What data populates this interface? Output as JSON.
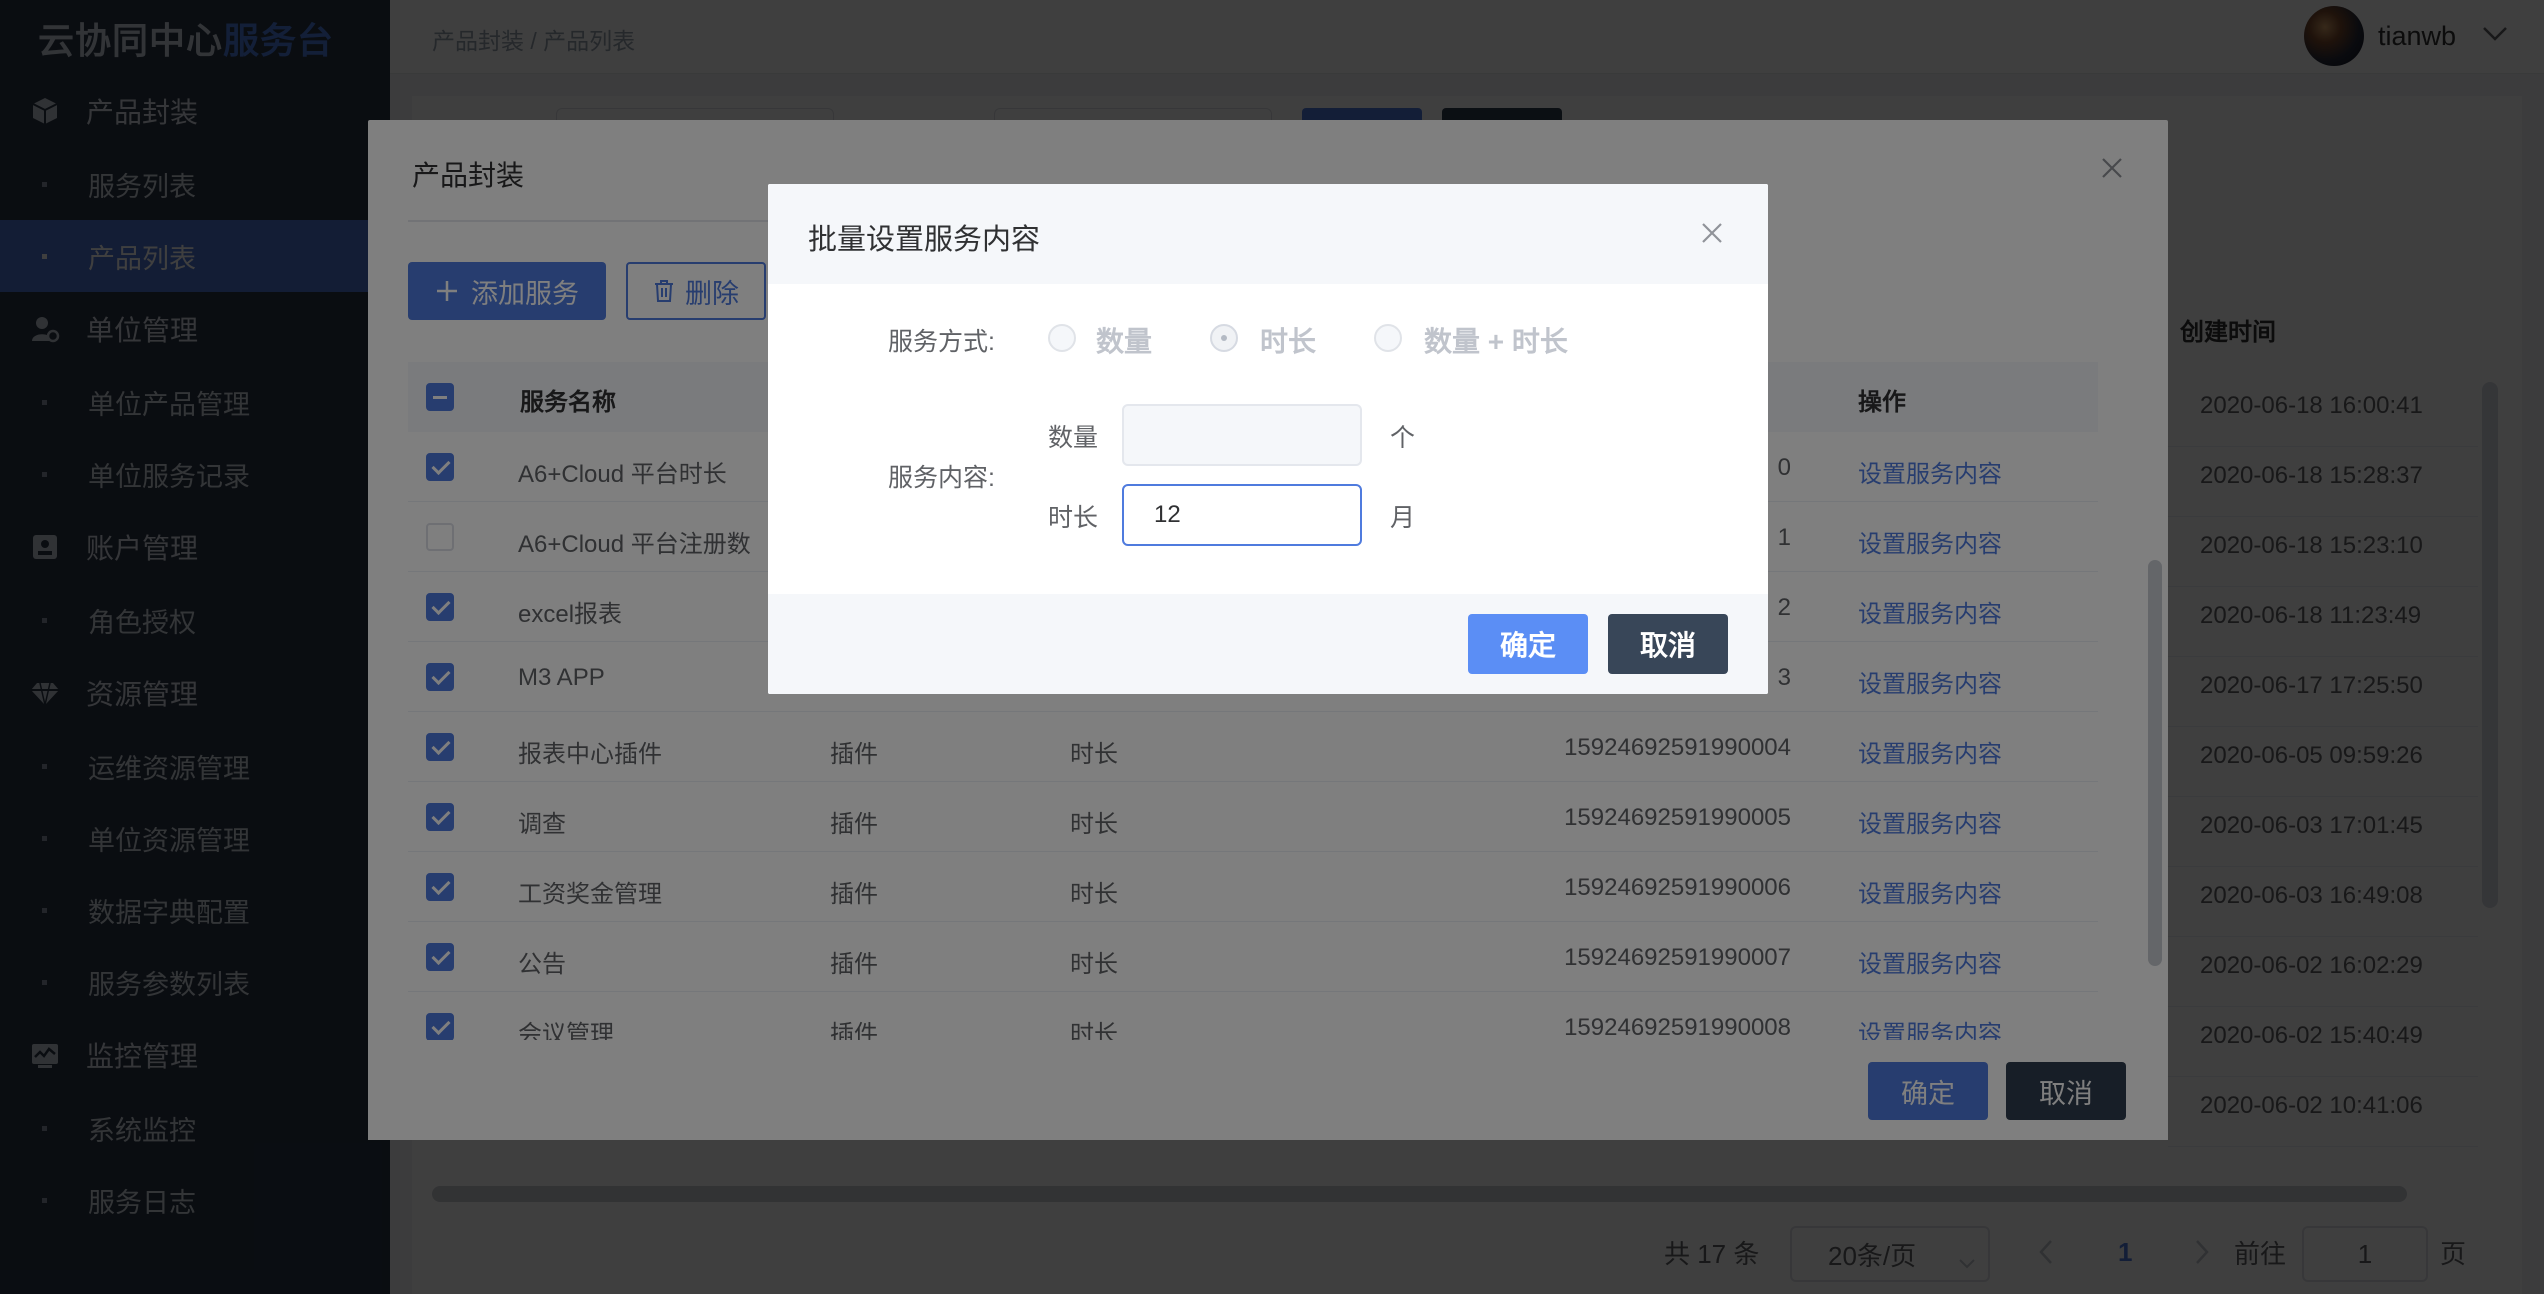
{
  "app": {
    "logo_part1": "云协同中心",
    "logo_part2": "服务台"
  },
  "sidebar": {
    "groups": [
      {
        "label": "产品封装",
        "icon": "cube-icon",
        "items": [
          "服务列表",
          "产品列表"
        ]
      },
      {
        "label": "单位管理",
        "icon": "user-gear-icon",
        "items": [
          "单位产品管理",
          "单位服务记录"
        ]
      },
      {
        "label": "账户管理",
        "icon": "id-badge-icon",
        "items": [
          "角色授权"
        ]
      },
      {
        "label": "资源管理",
        "icon": "diamond-icon",
        "items": [
          "运维资源管理",
          "单位资源管理",
          "数据字典配置",
          "服务参数列表"
        ]
      },
      {
        "label": "监控管理",
        "icon": "monitor-chart-icon",
        "items": [
          "系统监控",
          "服务日志"
        ]
      }
    ],
    "active_item": "产品列表"
  },
  "header": {
    "breadcrumb": "产品封装 / 产品列表",
    "username": "tianwb"
  },
  "background_table": {
    "column_header": "创建时间",
    "created_times": [
      "2020-06-18 16:00:41",
      "2020-06-18 15:28:37",
      "2020-06-18 15:23:10",
      "2020-06-18 11:23:49",
      "2020-06-17 17:25:50",
      "2020-06-05 09:59:26",
      "2020-06-03 17:01:45",
      "2020-06-03 16:49:08",
      "2020-06-02 16:02:29",
      "2020-06-02 15:40:49",
      "2020-06-02 10:41:06"
    ]
  },
  "pagination": {
    "total": "共 17 条",
    "page_size": "20条/页",
    "current_page": "1",
    "goto_prefix": "前往",
    "goto_value": "1",
    "goto_suffix": "页"
  },
  "outer_dialog": {
    "title": "产品封装",
    "add_button": "添加服务",
    "delete_button": "删除",
    "columns": {
      "name": "服务名称",
      "action": "操作"
    },
    "rows": [
      {
        "checked": true,
        "name": "A6+Cloud 平台时长",
        "type": "",
        "mode": "",
        "id_tail": "0",
        "action": "设置服务内容"
      },
      {
        "checked": false,
        "name": "A6+Cloud 平台注册数",
        "type": "",
        "mode": "",
        "id_tail": "1",
        "action": "设置服务内容"
      },
      {
        "checked": true,
        "name": "excel报表",
        "type": "",
        "mode": "",
        "id_tail": "2",
        "action": "设置服务内容"
      },
      {
        "checked": true,
        "name": "M3 APP",
        "type": "",
        "mode": "",
        "id_tail": "3",
        "action": "设置服务内容"
      },
      {
        "checked": true,
        "name": "报表中心插件",
        "type": "插件",
        "mode": "时长",
        "id_tail": "15924692591990004",
        "action": "设置服务内容"
      },
      {
        "checked": true,
        "name": "调查",
        "type": "插件",
        "mode": "时长",
        "id_tail": "15924692591990005",
        "action": "设置服务内容"
      },
      {
        "checked": true,
        "name": "工资奖金管理",
        "type": "插件",
        "mode": "时长",
        "id_tail": "15924692591990006",
        "action": "设置服务内容"
      },
      {
        "checked": true,
        "name": "公告",
        "type": "插件",
        "mode": "时长",
        "id_tail": "15924692591990007",
        "action": "设置服务内容"
      },
      {
        "checked": true,
        "name": "会议管理",
        "type": "插件",
        "mode": "时长",
        "id_tail": "15924692591990008",
        "action": "设置服务内容"
      }
    ],
    "ok_button": "确定",
    "cancel_button": "取消"
  },
  "inner_dialog": {
    "title": "批量设置服务内容",
    "service_mode_label": "服务方式:",
    "mode_options": [
      "数量",
      "时长",
      "数量 + 时长"
    ],
    "selected_mode": "时长",
    "content_label": "服务内容:",
    "quantity_label": "数量",
    "quantity_value": "",
    "quantity_unit": "个",
    "duration_label": "时长",
    "duration_value": "12",
    "duration_unit": "月",
    "ok_button": "确定",
    "cancel_button": "取消"
  }
}
